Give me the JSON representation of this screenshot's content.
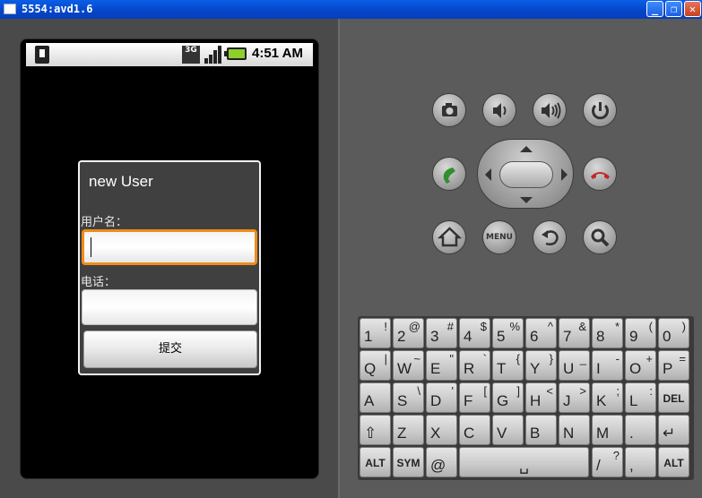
{
  "window": {
    "title": "5554:avd1.6",
    "min": "_",
    "restore": "❐",
    "close": "✕"
  },
  "status_bar": {
    "network": "3G",
    "time": "4:51 AM"
  },
  "dialog": {
    "title": "new User",
    "username_label": "用户名：",
    "username_value": "",
    "phone_label": "电话：",
    "phone_value": "",
    "submit_label": "提交"
  },
  "controls": {
    "menu_label": "MENU",
    "icons": [
      "camera-icon",
      "volume-down-icon",
      "volume-up-icon",
      "power-icon",
      "call-icon",
      "end-call-icon",
      "home-icon",
      "menu-icon",
      "back-icon",
      "search-icon"
    ]
  },
  "keyboard": {
    "rows": [
      [
        {
          "main": "1",
          "alt": "!"
        },
        {
          "main": "2",
          "alt": "@"
        },
        {
          "main": "3",
          "alt": "#"
        },
        {
          "main": "4",
          "alt": "$"
        },
        {
          "main": "5",
          "alt": "%"
        },
        {
          "main": "6",
          "alt": "^"
        },
        {
          "main": "7",
          "alt": "&"
        },
        {
          "main": "8",
          "alt": "*"
        },
        {
          "main": "9",
          "alt": "("
        },
        {
          "main": "0",
          "alt": ")"
        }
      ],
      [
        {
          "main": "Q",
          "alt": "|"
        },
        {
          "main": "W",
          "alt": "~"
        },
        {
          "main": "E",
          "alt": "\""
        },
        {
          "main": "R",
          "alt": "`"
        },
        {
          "main": "T",
          "alt": "{"
        },
        {
          "main": "Y",
          "alt": "}"
        },
        {
          "main": "U",
          "alt": "_"
        },
        {
          "main": "I",
          "alt": "-"
        },
        {
          "main": "O",
          "alt": "+"
        },
        {
          "main": "P",
          "alt": "="
        }
      ],
      [
        {
          "main": "A",
          "alt": ""
        },
        {
          "main": "S",
          "alt": "\\"
        },
        {
          "main": "D",
          "alt": "'"
        },
        {
          "main": "F",
          "alt": "["
        },
        {
          "main": "G",
          "alt": "]"
        },
        {
          "main": "H",
          "alt": "<"
        },
        {
          "main": "J",
          "alt": ">"
        },
        {
          "main": "K",
          "alt": ";"
        },
        {
          "main": "L",
          "alt": ":"
        },
        {
          "main": "DEL",
          "alt": ""
        }
      ],
      [
        {
          "main": "⇧",
          "alt": ""
        },
        {
          "main": "Z",
          "alt": ""
        },
        {
          "main": "X",
          "alt": ""
        },
        {
          "main": "C",
          "alt": ""
        },
        {
          "main": "V",
          "alt": ""
        },
        {
          "main": "B",
          "alt": ""
        },
        {
          "main": "N",
          "alt": ""
        },
        {
          "main": "M",
          "alt": ""
        },
        {
          "main": ".",
          "alt": ""
        },
        {
          "main": "↵",
          "alt": ""
        }
      ]
    ],
    "bottom": {
      "alt": "ALT",
      "sym": "SYM",
      "at": "@",
      "space": "␣",
      "slash": "/",
      "slash_alt": "?",
      "comma": ",",
      "alt2": "ALT"
    }
  }
}
